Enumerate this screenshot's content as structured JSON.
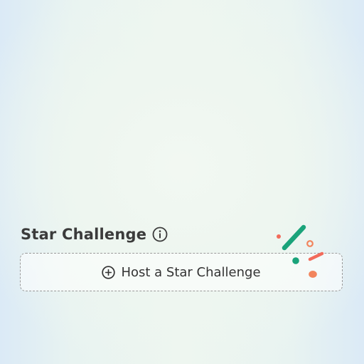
{
  "star_challenge": {
    "title": "Star Challenge",
    "host_button_label": "Host a Star Challenge"
  },
  "icons": {
    "info": "info-circle-icon",
    "host": "plus-circle-icon",
    "decoration": "confetti-icon"
  },
  "colors": {
    "title_text": "#3b3b3b",
    "button_text": "#333333",
    "button_border": "#9a9a9a",
    "confetti_green": "#1aa37a",
    "confetti_coral": "#f26b5b",
    "confetti_orange": "#f2845c"
  }
}
